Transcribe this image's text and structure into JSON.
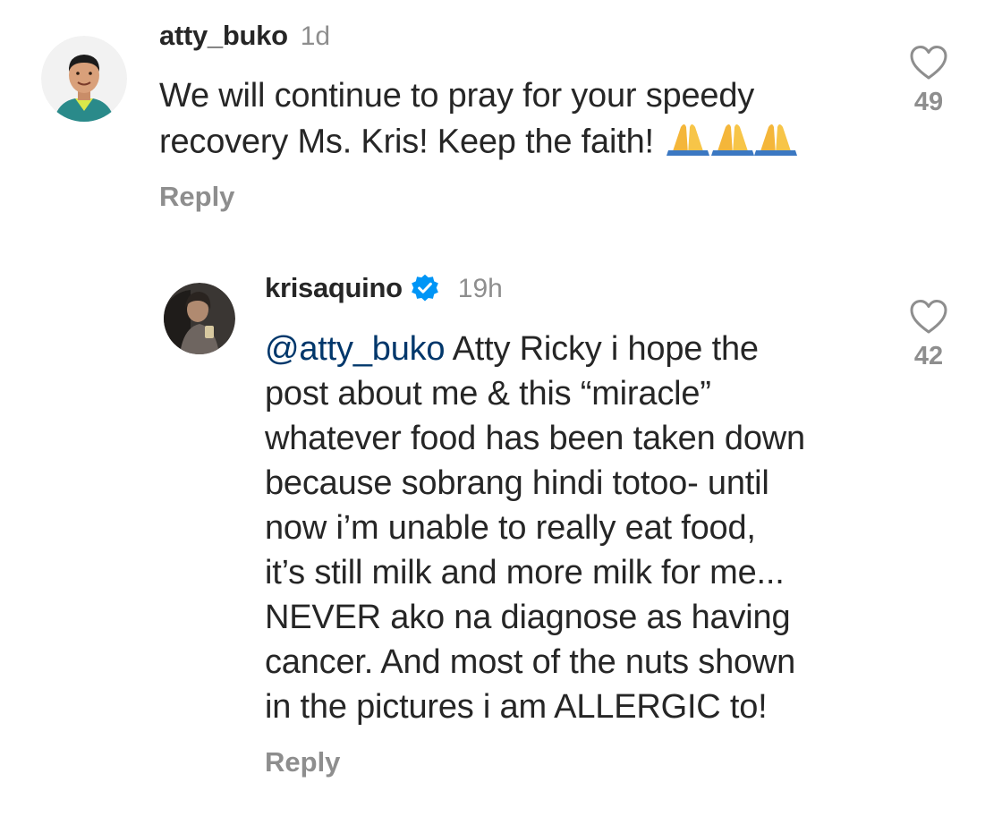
{
  "comments": [
    {
      "username": "atty_buko",
      "time": "1d",
      "lines": [
        "We will continue to pray for your speedy",
        "recovery Ms. Kris! Keep the faith!"
      ],
      "emoji": "🙏🙏🙏",
      "reply_label": "Reply",
      "likes": "49"
    },
    {
      "username": "krisaquino",
      "verified": true,
      "time": "19h",
      "mention": "@atty_buko",
      "lines": [
        "Atty Ricky i hope the",
        "post about me & this “miracle”",
        "whatever food has been taken down",
        "because sobrang hindi totoo- until",
        "now i’m unable to really eat food,",
        "it’s still milk and more milk for me...",
        "NEVER ako na diagnose as having",
        "cancer. And most of the nuts shown",
        "in the pictures i am ALLERGIC to!"
      ],
      "reply_label": "Reply",
      "likes": "42"
    }
  ],
  "colors": {
    "text": "#262626",
    "secondary": "#8e8e8e",
    "mention": "#00376b",
    "verified": "#0095f6"
  },
  "icons": {
    "like": "heart-outline-icon",
    "verified": "verified-badge-icon"
  }
}
